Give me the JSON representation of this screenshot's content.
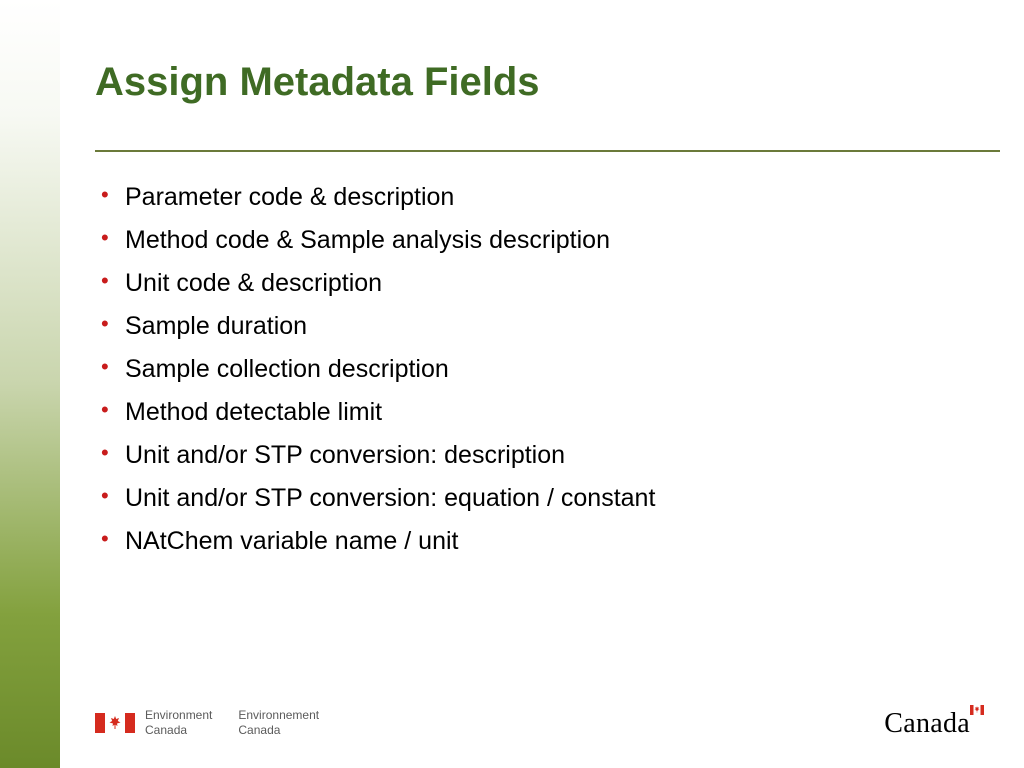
{
  "title": "Assign Metadata Fields",
  "bullets": [
    "Parameter code & description",
    "Method code & Sample analysis description",
    "Unit code & description",
    "Sample duration",
    "Sample collection description",
    "Method detectable limit",
    "Unit and/or STP conversion: description",
    "Unit and/or STP conversion: equation / constant",
    "NAtChem variable name / unit"
  ],
  "footer": {
    "dept_en_line1": "Environment",
    "dept_en_line2": "Canada",
    "dept_fr_line1": "Environnement",
    "dept_fr_line2": "Canada"
  },
  "wordmark": "Canada"
}
